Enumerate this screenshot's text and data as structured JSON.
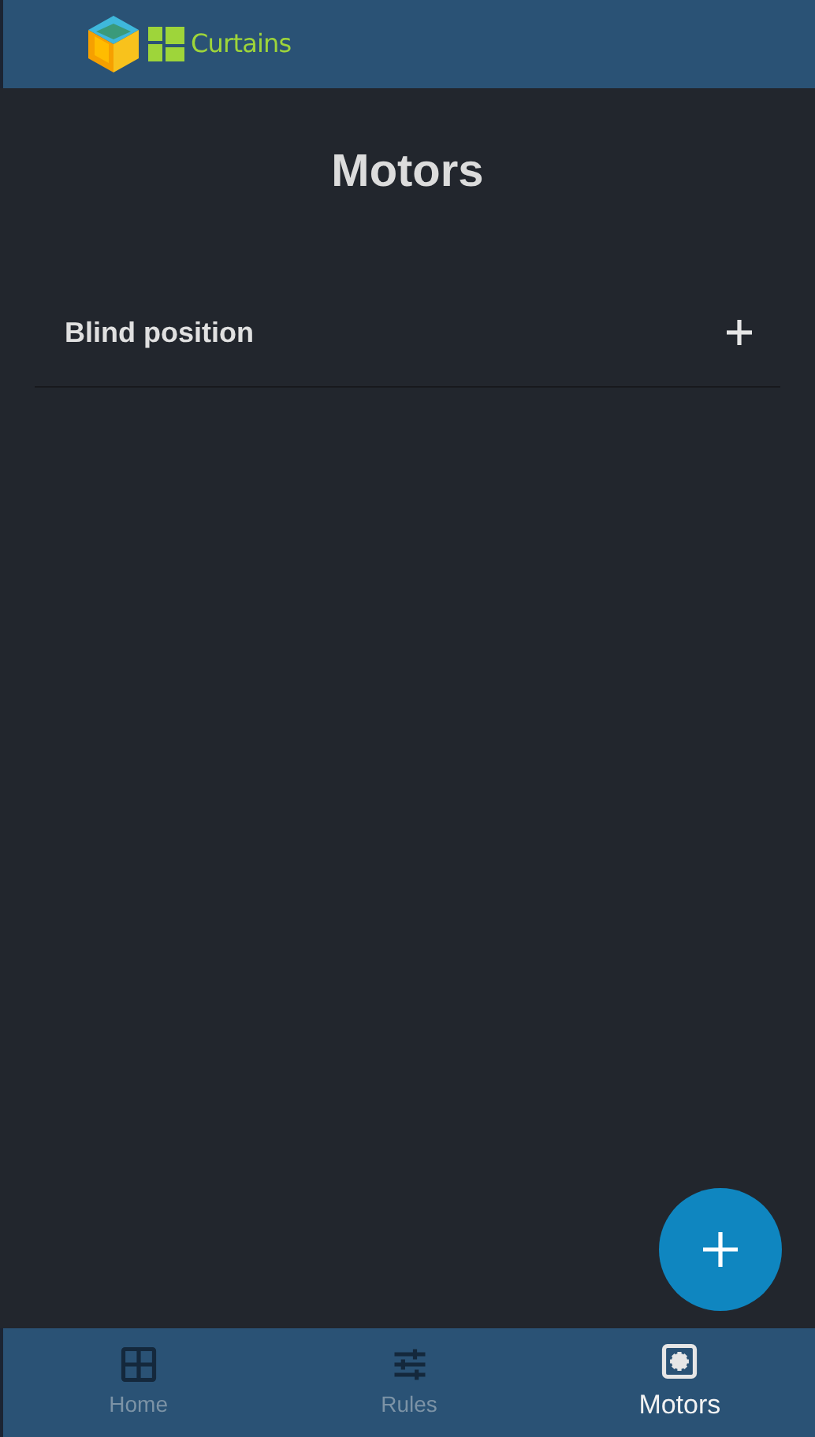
{
  "header": {
    "app_name": "Curtains"
  },
  "page_title": "Motors",
  "sections": [
    {
      "title": "Blind position",
      "expanded": false
    }
  ],
  "bottom_nav": [
    {
      "kind": "home",
      "label": "Home",
      "selected": false
    },
    {
      "kind": "rules",
      "label": "Rules",
      "selected": false
    },
    {
      "kind": "motors",
      "label": "Motors",
      "selected": true
    }
  ]
}
